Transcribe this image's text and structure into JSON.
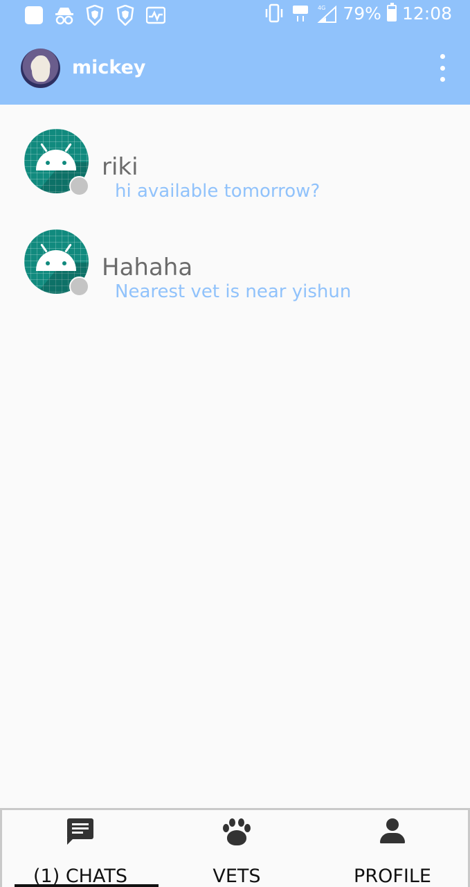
{
  "status_bar": {
    "left_icons": [
      "app-square-icon",
      "incognito-icon",
      "brave-shield-icon",
      "brave-shield-icon",
      "activity-icon"
    ],
    "right_icons": [
      "vibrate-icon",
      "volte-icon",
      "4g-signal-icon"
    ],
    "battery_percent_label": "79%",
    "battery_level": 0.79,
    "time": "12:08"
  },
  "app_bar": {
    "title": "mickey",
    "avatar_icon": "profile-photo-dog",
    "menu_icon": "more-vert-icon"
  },
  "chats": [
    {
      "name": "riki",
      "preview": "hi available tomorrow?",
      "avatar_icon": "android-icon",
      "presence": "offline"
    },
    {
      "name": "Hahaha",
      "preview": "Nearest vet is near yishun",
      "avatar_icon": "android-icon",
      "presence": "offline"
    }
  ],
  "bottom_nav": {
    "tabs": [
      {
        "label": "(1) CHATS",
        "icon": "chat-icon",
        "selected": true
      },
      {
        "label": "VETS",
        "icon": "paw-icon",
        "selected": false
      },
      {
        "label": "PROFILE",
        "icon": "person-icon",
        "selected": false
      }
    ]
  },
  "colors": {
    "primary": "#90c2fb",
    "background": "#fafafa",
    "avatar_teal": "#118a7e",
    "preview_text": "#90c2fb",
    "name_text": "#6b6b6b",
    "presence_offline": "#c4c4c4"
  }
}
